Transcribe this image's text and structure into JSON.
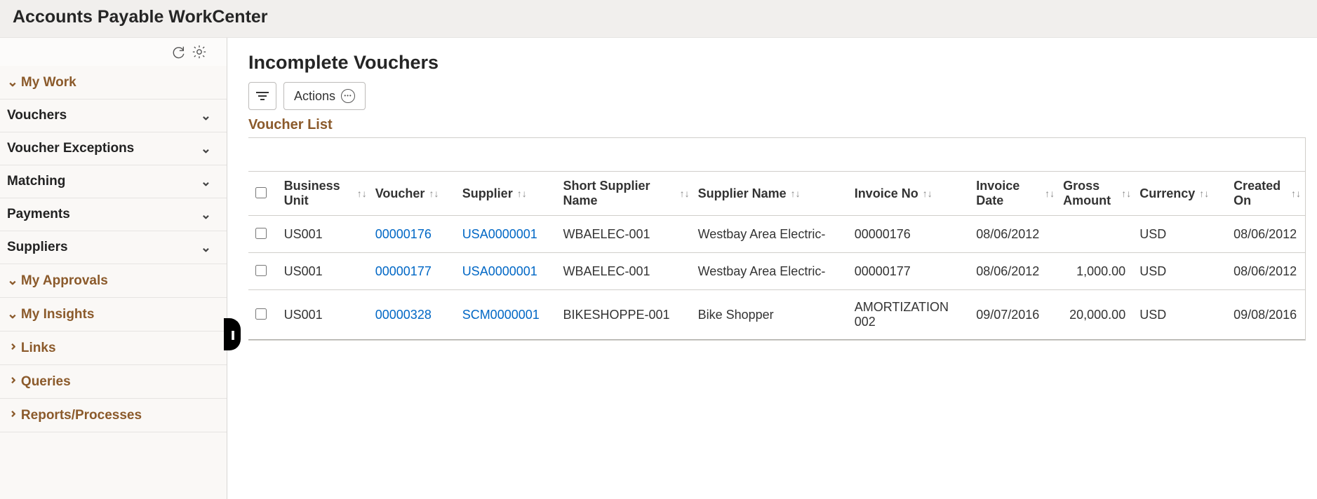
{
  "header": {
    "title": "Accounts Payable WorkCenter"
  },
  "sidebar": {
    "sections": [
      {
        "label": "My Work",
        "open": true,
        "items": [
          {
            "label": "Vouchers"
          },
          {
            "label": "Voucher Exceptions"
          },
          {
            "label": "Matching"
          },
          {
            "label": "Payments"
          },
          {
            "label": "Suppliers"
          }
        ]
      },
      {
        "label": "My Approvals",
        "open": true,
        "items": []
      },
      {
        "label": "My Insights",
        "open": true,
        "items": []
      },
      {
        "label": "Links",
        "open": false,
        "items": []
      },
      {
        "label": "Queries",
        "open": false,
        "items": []
      },
      {
        "label": "Reports/Processes",
        "open": false,
        "items": []
      }
    ]
  },
  "main": {
    "title": "Incomplete Vouchers",
    "actions_label": "Actions",
    "section_title": "Voucher List",
    "columns": [
      {
        "label": "Business Unit"
      },
      {
        "label": "Voucher"
      },
      {
        "label": "Supplier"
      },
      {
        "label": "Short Supplier Name"
      },
      {
        "label": "Supplier Name"
      },
      {
        "label": "Invoice No"
      },
      {
        "label": "Invoice Date"
      },
      {
        "label": "Gross Amount"
      },
      {
        "label": "Currency"
      },
      {
        "label": "Created On"
      }
    ],
    "rows": [
      {
        "bu": "US001",
        "voucher": "00000176",
        "supplier": "USA0000001",
        "short": "WBAELEC-001",
        "supname": "Westbay Area Electric-",
        "invoice": "00000176",
        "invdate": "08/06/2012",
        "gross": "",
        "currency": "USD",
        "created": "08/06/2012"
      },
      {
        "bu": "US001",
        "voucher": "00000177",
        "supplier": "USA0000001",
        "short": "WBAELEC-001",
        "supname": "Westbay Area Electric-",
        "invoice": "00000177",
        "invdate": "08/06/2012",
        "gross": "1,000.00",
        "currency": "USD",
        "created": "08/06/2012"
      },
      {
        "bu": "US001",
        "voucher": "00000328",
        "supplier": "SCM0000001",
        "short": "BIKESHOPPE-001",
        "supname": "Bike Shopper",
        "invoice": "AMORTIZATION 002",
        "invdate": "09/07/2016",
        "gross": "20,000.00",
        "currency": "USD",
        "created": "09/08/2016"
      }
    ]
  }
}
